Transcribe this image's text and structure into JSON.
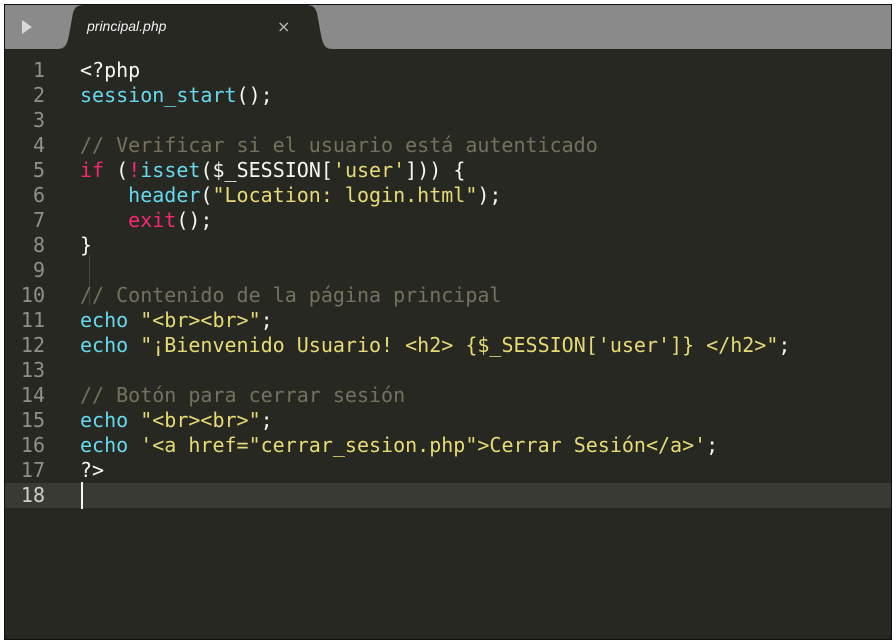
{
  "tab": {
    "title": "principal.php",
    "close_glyph": "×"
  },
  "icons": {
    "sidebar_toggle": "play-triangle-icon",
    "tab_close": "close-icon"
  },
  "colors": {
    "background": "#272822",
    "keyword": "#f92672",
    "function": "#66d9ef",
    "string": "#e6db74",
    "comment": "#75715e",
    "plain": "#f8f8f2",
    "tab_bar": "#8a8a8a"
  },
  "editor": {
    "language": "php",
    "current_line": 18,
    "lines": [
      {
        "number": "1",
        "tokens": [
          {
            "t": "<?php",
            "c": "plain"
          }
        ]
      },
      {
        "number": "2",
        "tokens": [
          {
            "t": "session_start",
            "c": "func"
          },
          {
            "t": "();",
            "c": "plain"
          }
        ]
      },
      {
        "number": "3",
        "tokens": []
      },
      {
        "number": "4",
        "tokens": [
          {
            "t": "// Verificar si el usuario está autenticado",
            "c": "comment"
          }
        ]
      },
      {
        "number": "5",
        "tokens": [
          {
            "t": "if",
            "c": "keyword"
          },
          {
            "t": " (",
            "c": "plain"
          },
          {
            "t": "!",
            "c": "keyword"
          },
          {
            "t": "isset",
            "c": "func"
          },
          {
            "t": "($_SESSION[",
            "c": "plain"
          },
          {
            "t": "'user'",
            "c": "string"
          },
          {
            "t": "])) {",
            "c": "plain"
          }
        ]
      },
      {
        "number": "6",
        "tokens": [
          {
            "t": "    ",
            "c": "plain"
          },
          {
            "t": "header",
            "c": "func"
          },
          {
            "t": "(",
            "c": "plain"
          },
          {
            "t": "\"Location: login.html\"",
            "c": "string"
          },
          {
            "t": ");",
            "c": "plain"
          }
        ]
      },
      {
        "number": "7",
        "tokens": [
          {
            "t": "    ",
            "c": "plain"
          },
          {
            "t": "exit",
            "c": "keyword"
          },
          {
            "t": "();",
            "c": "plain"
          }
        ]
      },
      {
        "number": "8",
        "tokens": [
          {
            "t": "}",
            "c": "plain"
          }
        ]
      },
      {
        "number": "9",
        "tokens": []
      },
      {
        "number": "10",
        "tokens": [
          {
            "t": "// Contenido de la página principal",
            "c": "comment"
          }
        ]
      },
      {
        "number": "11",
        "tokens": [
          {
            "t": "echo",
            "c": "func"
          },
          {
            "t": " ",
            "c": "plain"
          },
          {
            "t": "\"<br><br>\"",
            "c": "string"
          },
          {
            "t": ";",
            "c": "plain"
          }
        ]
      },
      {
        "number": "12",
        "tokens": [
          {
            "t": "echo",
            "c": "func"
          },
          {
            "t": " ",
            "c": "plain"
          },
          {
            "t": "\"¡Bienvenido Usuario! <h2> {$_SESSION['user']} </h2>\"",
            "c": "string"
          },
          {
            "t": ";",
            "c": "plain"
          }
        ]
      },
      {
        "number": "13",
        "tokens": []
      },
      {
        "number": "14",
        "tokens": [
          {
            "t": "// Botón para cerrar sesión",
            "c": "comment"
          }
        ]
      },
      {
        "number": "15",
        "tokens": [
          {
            "t": "echo",
            "c": "func"
          },
          {
            "t": " ",
            "c": "plain"
          },
          {
            "t": "\"<br><br>\"",
            "c": "string"
          },
          {
            "t": ";",
            "c": "plain"
          }
        ]
      },
      {
        "number": "16",
        "tokens": [
          {
            "t": "echo",
            "c": "func"
          },
          {
            "t": " ",
            "c": "plain"
          },
          {
            "t": "'<a href=\"cerrar_sesion.php\">Cerrar Sesión</a>'",
            "c": "string"
          },
          {
            "t": ";",
            "c": "plain"
          }
        ]
      },
      {
        "number": "17",
        "tokens": [
          {
            "t": "?>",
            "c": "plain"
          }
        ]
      },
      {
        "number": "18",
        "tokens": []
      }
    ]
  }
}
